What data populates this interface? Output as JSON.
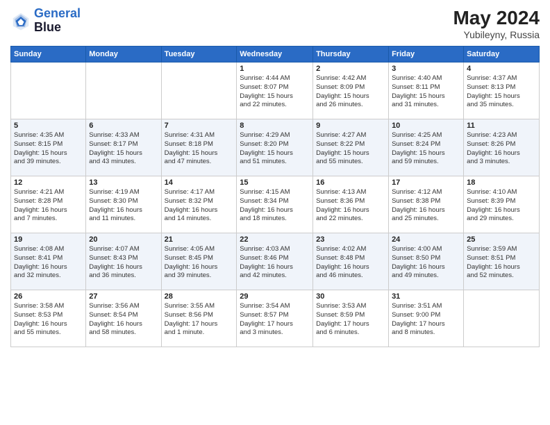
{
  "header": {
    "logo_line1": "General",
    "logo_line2": "Blue",
    "month_year": "May 2024",
    "location": "Yubileyny, Russia"
  },
  "weekdays": [
    "Sunday",
    "Monday",
    "Tuesday",
    "Wednesday",
    "Thursday",
    "Friday",
    "Saturday"
  ],
  "weeks": [
    [
      {
        "day": "",
        "info": ""
      },
      {
        "day": "",
        "info": ""
      },
      {
        "day": "",
        "info": ""
      },
      {
        "day": "1",
        "info": "Sunrise: 4:44 AM\nSunset: 8:07 PM\nDaylight: 15 hours\nand 22 minutes."
      },
      {
        "day": "2",
        "info": "Sunrise: 4:42 AM\nSunset: 8:09 PM\nDaylight: 15 hours\nand 26 minutes."
      },
      {
        "day": "3",
        "info": "Sunrise: 4:40 AM\nSunset: 8:11 PM\nDaylight: 15 hours\nand 31 minutes."
      },
      {
        "day": "4",
        "info": "Sunrise: 4:37 AM\nSunset: 8:13 PM\nDaylight: 15 hours\nand 35 minutes."
      }
    ],
    [
      {
        "day": "5",
        "info": "Sunrise: 4:35 AM\nSunset: 8:15 PM\nDaylight: 15 hours\nand 39 minutes."
      },
      {
        "day": "6",
        "info": "Sunrise: 4:33 AM\nSunset: 8:17 PM\nDaylight: 15 hours\nand 43 minutes."
      },
      {
        "day": "7",
        "info": "Sunrise: 4:31 AM\nSunset: 8:18 PM\nDaylight: 15 hours\nand 47 minutes."
      },
      {
        "day": "8",
        "info": "Sunrise: 4:29 AM\nSunset: 8:20 PM\nDaylight: 15 hours\nand 51 minutes."
      },
      {
        "day": "9",
        "info": "Sunrise: 4:27 AM\nSunset: 8:22 PM\nDaylight: 15 hours\nand 55 minutes."
      },
      {
        "day": "10",
        "info": "Sunrise: 4:25 AM\nSunset: 8:24 PM\nDaylight: 15 hours\nand 59 minutes."
      },
      {
        "day": "11",
        "info": "Sunrise: 4:23 AM\nSunset: 8:26 PM\nDaylight: 16 hours\nand 3 minutes."
      }
    ],
    [
      {
        "day": "12",
        "info": "Sunrise: 4:21 AM\nSunset: 8:28 PM\nDaylight: 16 hours\nand 7 minutes."
      },
      {
        "day": "13",
        "info": "Sunrise: 4:19 AM\nSunset: 8:30 PM\nDaylight: 16 hours\nand 11 minutes."
      },
      {
        "day": "14",
        "info": "Sunrise: 4:17 AM\nSunset: 8:32 PM\nDaylight: 16 hours\nand 14 minutes."
      },
      {
        "day": "15",
        "info": "Sunrise: 4:15 AM\nSunset: 8:34 PM\nDaylight: 16 hours\nand 18 minutes."
      },
      {
        "day": "16",
        "info": "Sunrise: 4:13 AM\nSunset: 8:36 PM\nDaylight: 16 hours\nand 22 minutes."
      },
      {
        "day": "17",
        "info": "Sunrise: 4:12 AM\nSunset: 8:38 PM\nDaylight: 16 hours\nand 25 minutes."
      },
      {
        "day": "18",
        "info": "Sunrise: 4:10 AM\nSunset: 8:39 PM\nDaylight: 16 hours\nand 29 minutes."
      }
    ],
    [
      {
        "day": "19",
        "info": "Sunrise: 4:08 AM\nSunset: 8:41 PM\nDaylight: 16 hours\nand 32 minutes."
      },
      {
        "day": "20",
        "info": "Sunrise: 4:07 AM\nSunset: 8:43 PM\nDaylight: 16 hours\nand 36 minutes."
      },
      {
        "day": "21",
        "info": "Sunrise: 4:05 AM\nSunset: 8:45 PM\nDaylight: 16 hours\nand 39 minutes."
      },
      {
        "day": "22",
        "info": "Sunrise: 4:03 AM\nSunset: 8:46 PM\nDaylight: 16 hours\nand 42 minutes."
      },
      {
        "day": "23",
        "info": "Sunrise: 4:02 AM\nSunset: 8:48 PM\nDaylight: 16 hours\nand 46 minutes."
      },
      {
        "day": "24",
        "info": "Sunrise: 4:00 AM\nSunset: 8:50 PM\nDaylight: 16 hours\nand 49 minutes."
      },
      {
        "day": "25",
        "info": "Sunrise: 3:59 AM\nSunset: 8:51 PM\nDaylight: 16 hours\nand 52 minutes."
      }
    ],
    [
      {
        "day": "26",
        "info": "Sunrise: 3:58 AM\nSunset: 8:53 PM\nDaylight: 16 hours\nand 55 minutes."
      },
      {
        "day": "27",
        "info": "Sunrise: 3:56 AM\nSunset: 8:54 PM\nDaylight: 16 hours\nand 58 minutes."
      },
      {
        "day": "28",
        "info": "Sunrise: 3:55 AM\nSunset: 8:56 PM\nDaylight: 17 hours\nand 1 minute."
      },
      {
        "day": "29",
        "info": "Sunrise: 3:54 AM\nSunset: 8:57 PM\nDaylight: 17 hours\nand 3 minutes."
      },
      {
        "day": "30",
        "info": "Sunrise: 3:53 AM\nSunset: 8:59 PM\nDaylight: 17 hours\nand 6 minutes."
      },
      {
        "day": "31",
        "info": "Sunrise: 3:51 AM\nSunset: 9:00 PM\nDaylight: 17 hours\nand 8 minutes."
      },
      {
        "day": "",
        "info": ""
      }
    ]
  ]
}
